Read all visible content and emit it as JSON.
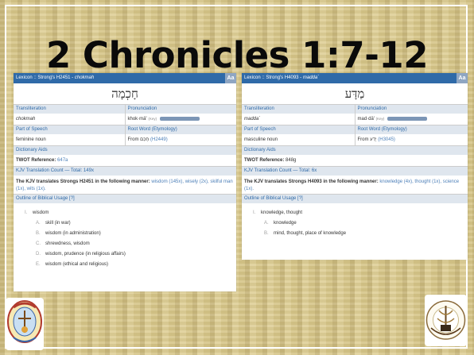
{
  "title": "2 Chronicles 1:7-12",
  "left": {
    "header": "Lexicon :: Strong's H2451 - ",
    "header_word": "chokmah",
    "aa": "Aa",
    "hebrew": "חָכְמָה",
    "labels": {
      "translit": "Transliteration",
      "pron": "Pronunciation",
      "pos": "Part of Speech",
      "root": "Root Word (Etymology)",
      "aids": "Dictionary Aids",
      "kjv": "KJV Translation Count — Total: 149x",
      "outline": "Outline of Biblical Usage [?]"
    },
    "translit": "chokmah",
    "pron": "khok·mä'",
    "key": "(Key)",
    "pos": "feminine noun",
    "root_prefix": "From",
    "root_heb": "חָכַם",
    "root_ref": "(H2449)",
    "twot_label": "TWOT Reference:",
    "twot_val": "647a",
    "kjv_text": "The KJV translates Strongs H2451 in the following manner:",
    "kjv_rest": "wisdom (145x), wisely (2x), skilful man (1x), wits (1x).",
    "outline": [
      {
        "n": "I.",
        "text": "wisdom",
        "level": 1
      },
      {
        "n": "A.",
        "text": "skill (in war)",
        "level": 2
      },
      {
        "n": "B.",
        "text": "wisdom (in administration)",
        "level": 2
      },
      {
        "n": "C.",
        "text": "shrewdness, wisdom",
        "level": 2
      },
      {
        "n": "D.",
        "text": "wisdom, prudence (in religious affairs)",
        "level": 2
      },
      {
        "n": "E.",
        "text": "wisdom (ethical and religious)",
        "level": 2
      }
    ]
  },
  "right": {
    "header": "Lexicon :: Strong's H4093 - ",
    "header_word": "madda`",
    "aa": "Aa",
    "hebrew": "מַדָּע",
    "labels": {
      "translit": "Transliteration",
      "pron": "Pronunciation",
      "pos": "Part of Speech",
      "root": "Root Word (Etymology)",
      "aids": "Dictionary Aids",
      "kjv": "KJV Translation Count — Total: 6x",
      "outline": "Outline of Biblical Usage [?]"
    },
    "translit": "madda`",
    "pron": "mad·dä'",
    "key": "(Key)",
    "pos": "masculine noun",
    "root_prefix": "From",
    "root_heb": "יָדַע",
    "root_ref": "(H3045)",
    "twot_label": "TWOT Reference:",
    "twot_val": "848g",
    "kjv_text": "The KJV translates Strongs H4093 in the following manner:",
    "kjv_rest": "knowledge (4x), thought (1x), science (1x).",
    "outline": [
      {
        "n": "I.",
        "text": "knowledge, thought",
        "level": 1
      },
      {
        "n": "A.",
        "text": "knowledge",
        "level": 2
      },
      {
        "n": "B.",
        "text": "mind, thought, place of knowledge",
        "level": 2
      }
    ]
  },
  "logo_left_text": "Spirit & Truth Revival Ministry",
  "logo_right_text": "Bucks County Bible Assembly"
}
